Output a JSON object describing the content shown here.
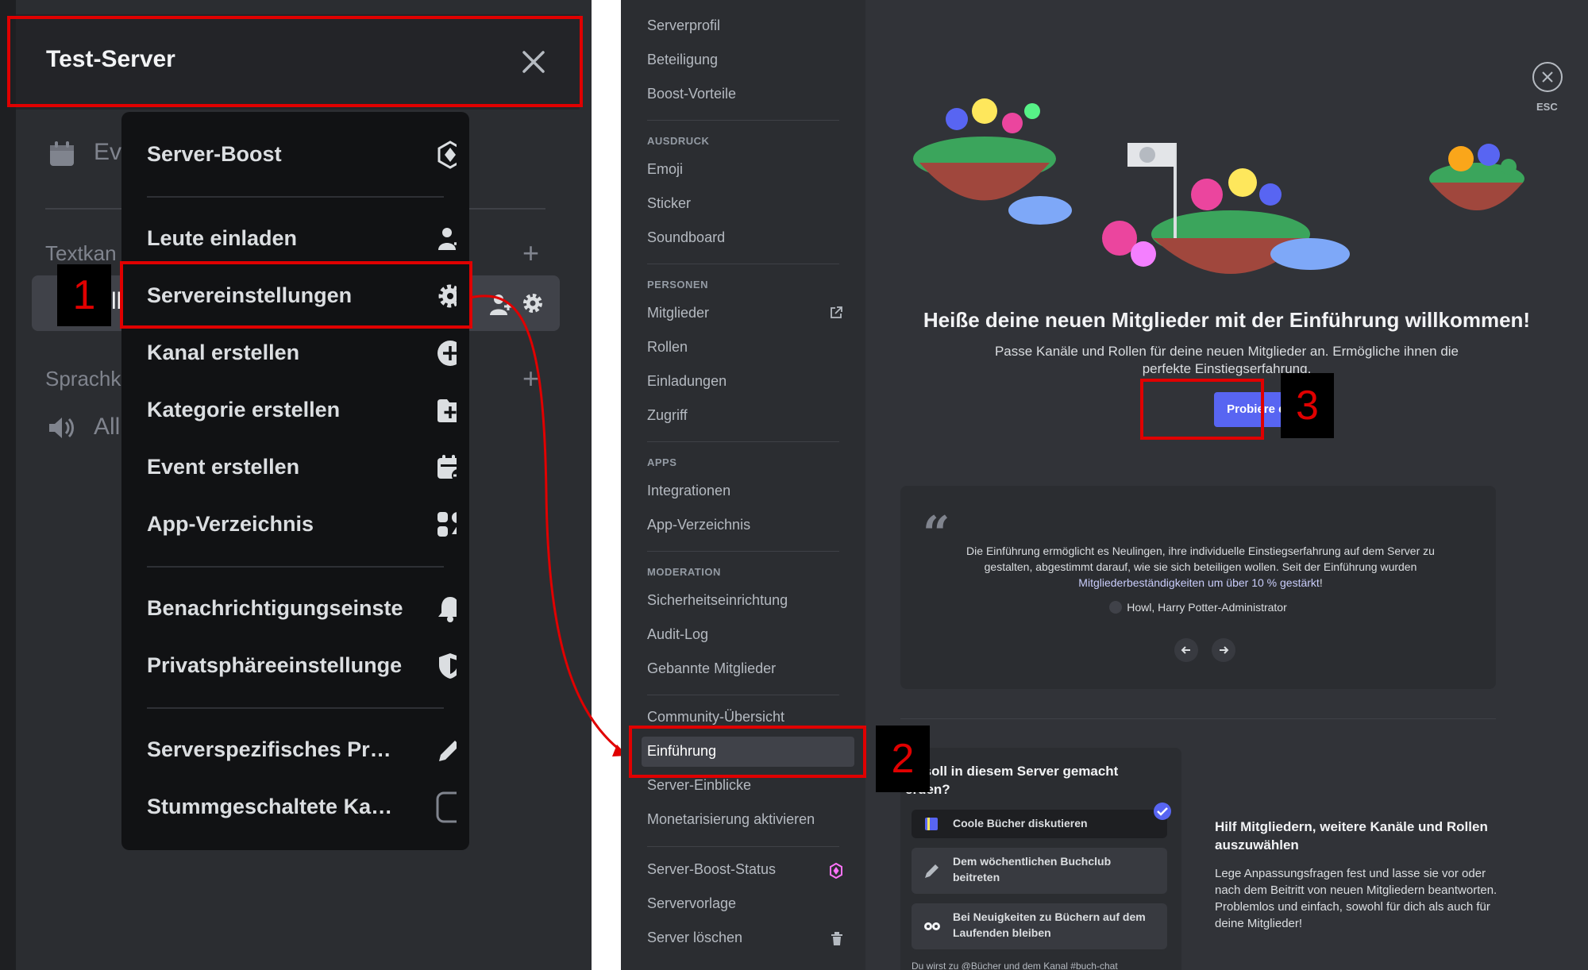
{
  "server_menu": {
    "server_name": "Test-Server",
    "background": {
      "events_label": "Ev",
      "text_category": "Textkan",
      "voice_category": "Sprachk",
      "channel_fragment": "ll",
      "voice_channel_fragment": "All"
    },
    "items": [
      {
        "label": "Server-Boost",
        "icon": "boost-gem-icon"
      },
      {
        "label": "Leute einladen",
        "icon": "invite-people-icon"
      },
      {
        "label": "Servereinstellungen",
        "icon": "gear-icon"
      },
      {
        "label": "Kanal erstellen",
        "icon": "plus-circle-icon"
      },
      {
        "label": "Kategorie erstellen",
        "icon": "folder-plus-icon"
      },
      {
        "label": "Event erstellen",
        "icon": "calendar-plus-icon"
      },
      {
        "label": "App-Verzeichnis",
        "icon": "app-directory-icon"
      },
      {
        "label": "Benachrichtigungseinstellungen",
        "icon": "bell-icon"
      },
      {
        "label": "Privatsphäreeinstellungen",
        "icon": "shield-icon"
      },
      {
        "label": "Serverspezifisches Profil bearbeiten",
        "icon": "pencil-icon"
      },
      {
        "label": "Stummgeschaltete Kanäle ausblenden",
        "icon": "checkbox-icon"
      }
    ]
  },
  "annotations": {
    "step1": "1",
    "step2": "2",
    "step3": "3",
    "highlight_color": "#e00000"
  },
  "settings_nav": {
    "items_top": [
      "Serverprofil",
      "Beteiligung",
      "Boost-Vorteile"
    ],
    "section_expression": "AUSDRUCK",
    "items_expression": [
      "Emoji",
      "Sticker",
      "Soundboard"
    ],
    "section_people": "PERSONEN",
    "items_people": [
      "Mitglieder",
      "Rollen",
      "Einladungen",
      "Zugriff"
    ],
    "section_apps": "APPS",
    "items_apps": [
      "Integrationen",
      "App-Verzeichnis"
    ],
    "section_moderation": "MODERATION",
    "items_moderation": [
      "Sicherheitseinrichtung",
      "Audit-Log",
      "Gebannte Mitglieder"
    ],
    "items_community": [
      "Community-Übersicht",
      "Einführung",
      "Server-Einblicke",
      "Monetarisierung aktivieren"
    ],
    "items_bottom": [
      "Server-Boost-Status",
      "Servervorlage",
      "Server löschen"
    ],
    "active_item": "Einführung"
  },
  "onboarding": {
    "esc_label": "ESC",
    "title": "Heiße deine neuen Mitglieder mit der Einführung willkommen!",
    "subtitle": "Passe Kanäle und Rollen für deine neuen Mitglieder an. Ermögliche ihnen die perfekte Einstiegserfahrung.",
    "try_button": "Probiere es aus",
    "quote_text_part1": "Die Einführung ermöglicht es Neulingen, ihre individuelle Einstiegserfahrung auf dem Server zu gestalten, abgestimmt darauf, wie sie sich beteiligen wollen. Seit der Einführung wurden ",
    "quote_highlight": "Mitgliederbeständigkeiten um über 10 % gestärkt",
    "quote_text_part2": "!",
    "quote_author": "Howl, Harry Potter-Administrator",
    "question_title": "as soll in diesem Server gemacht erden?",
    "options": [
      "Coole Bücher diskutieren",
      "Dem wöchentlichen Buchclub beitreten",
      "Bei Neuigkeiten zu Büchern auf dem Laufenden bleiben"
    ],
    "question_footer": "Du wirst zu @Bücher und dem Kanal #buch-chat",
    "help_title": "Hilf Mitgliedern, weitere Kanäle und Rollen auszuwählen",
    "help_text": "Lege Anpassungsfragen fest und lasse sie vor oder nach dem Beitritt von neuen Mitgliedern beantworten. Problemlos und einfach, sowohl für dich als auch für deine Mitglieder!",
    "accent_color": "#5865f2"
  }
}
